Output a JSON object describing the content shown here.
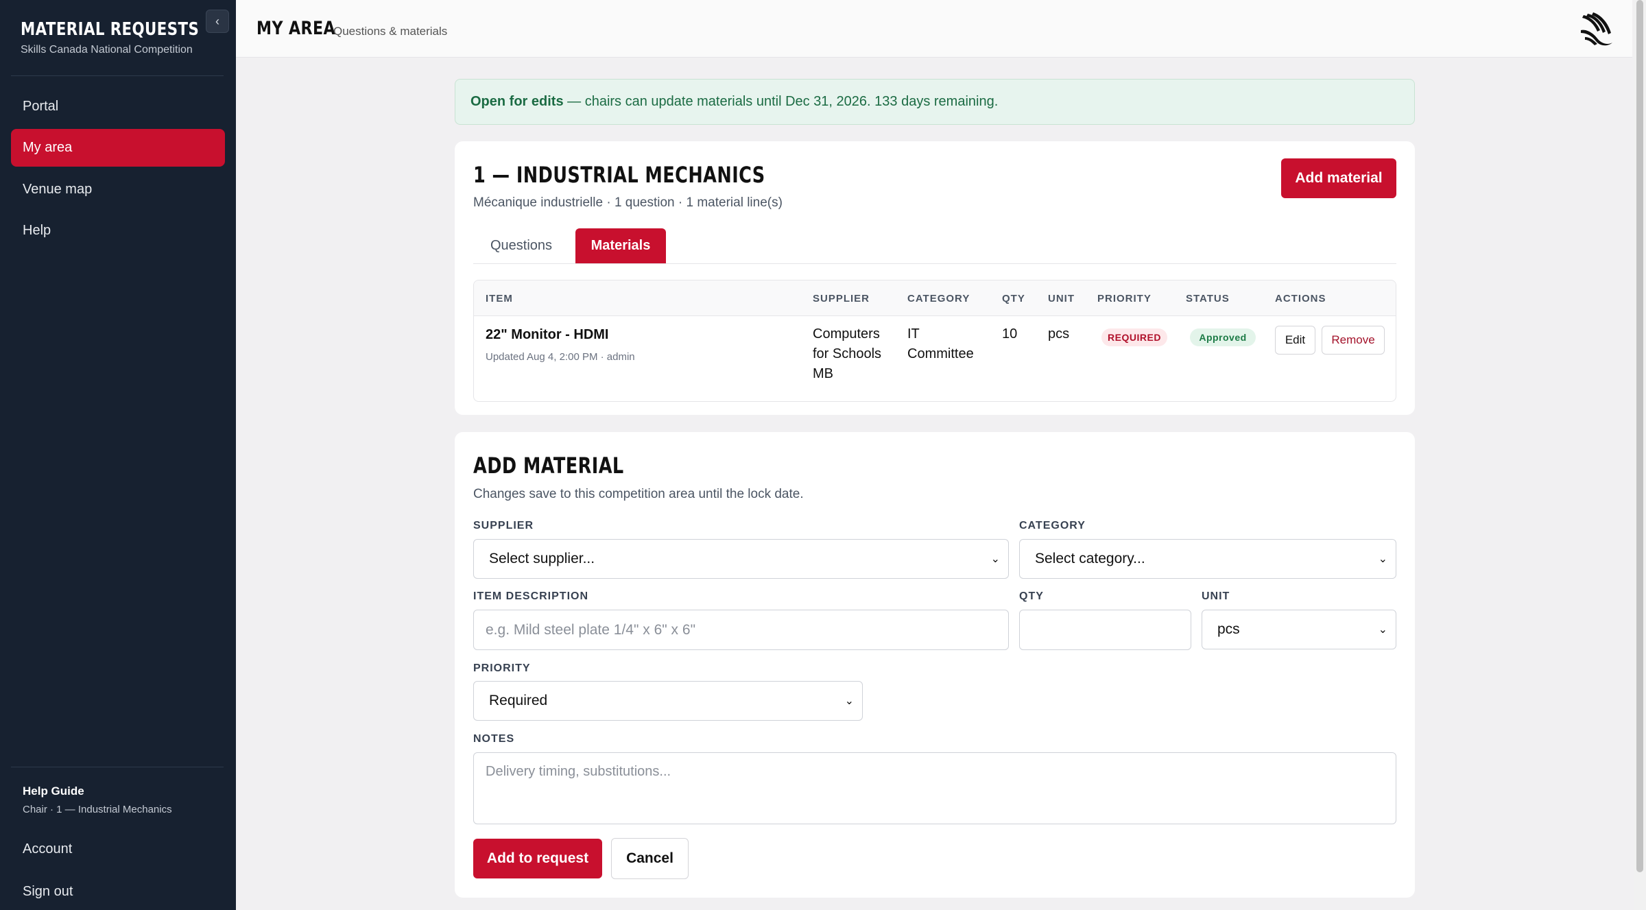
{
  "sidebar": {
    "brand_title": "MATERIAL REQUESTS",
    "brand_sub": "Skills Canada National Competition",
    "collapse_icon": "chevron-left-icon",
    "nav": [
      {
        "label": "Portal",
        "active": false
      },
      {
        "label": "My area",
        "active": true
      },
      {
        "label": "Venue map",
        "active": false
      },
      {
        "label": "Help",
        "active": false
      }
    ],
    "guide_title": "Help Guide",
    "guide_sub": "Chair · 1 — Industrial Mechanics",
    "account": "Account",
    "sign_out": "Sign out"
  },
  "header": {
    "title": "MY AREA",
    "subtitle": "Questions & materials",
    "logo_icon": "brand-logo-icon"
  },
  "banner": {
    "strong": "Open for edits",
    "text": " — chairs can update materials until Dec 31, 2026. 133 days remaining."
  },
  "area_card": {
    "title": "1 — INDUSTRIAL MECHANICS",
    "subtitle": "Mécanique industrielle · 1 question · 1 material line(s)",
    "add_button": "Add material",
    "tabs": [
      {
        "label": "Questions",
        "active": false
      },
      {
        "label": "Materials",
        "active": true
      }
    ],
    "table": {
      "headers": [
        "ITEM",
        "SUPPLIER",
        "CATEGORY",
        "QTY",
        "UNIT",
        "PRIORITY",
        "STATUS",
        "ACTIONS"
      ],
      "rows": [
        {
          "item": "22\" Monitor - HDMI",
          "meta": "Updated Aug 4, 2:00 PM · admin",
          "supplier_lines": [
            "Computers",
            "for Schools",
            "MB"
          ],
          "category_lines": [
            "IT",
            "Committee"
          ],
          "qty": "10",
          "unit": "pcs",
          "priority": "REQUIRED",
          "status": "Approved",
          "edit": "Edit",
          "remove": "Remove"
        }
      ]
    }
  },
  "form": {
    "title": "ADD MATERIAL",
    "subtitle": "Changes save to this competition area until the lock date.",
    "supplier_label": "SUPPLIER",
    "supplier_value": "Select supplier...",
    "category_label": "CATEGORY",
    "category_value": "Select category...",
    "item_label": "ITEM DESCRIPTION",
    "item_placeholder": "e.g. Mild steel plate 1/4\" x 6\" x 6\"",
    "qty_label": "QTY",
    "qty_value": "",
    "unit_label": "UNIT",
    "unit_value": "pcs",
    "priority_label": "PRIORITY",
    "priority_value": "Required",
    "notes_label": "NOTES",
    "notes_placeholder": "Delivery timing, substitutions...",
    "submit": "Add to request",
    "cancel": "Cancel"
  },
  "colors": {
    "accent": "#c8102e",
    "sidebar_bg": "#172130",
    "banner_bg": "#e7f4ee",
    "banner_text": "#1b6b43"
  }
}
